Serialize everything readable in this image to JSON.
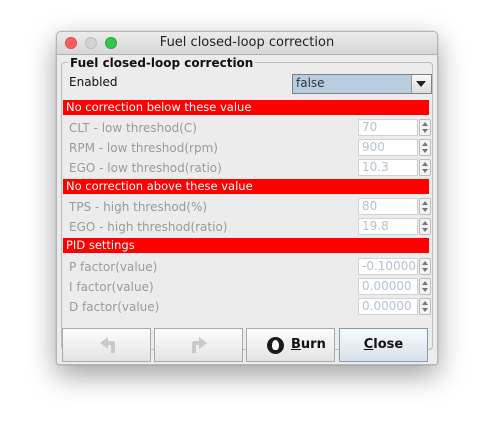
{
  "window": {
    "title": "Fuel closed-loop correction"
  },
  "panel": {
    "title": "Fuel closed-loop correction"
  },
  "enabled": {
    "label": "Enabled",
    "value": "false"
  },
  "sections": {
    "below": "No correction below these value",
    "above": "No correction above these value",
    "pid": "PID settings"
  },
  "fields": {
    "clt_low": {
      "label": "CLT - low threshod(C)",
      "value": "70"
    },
    "rpm_low": {
      "label": "RPM - low threshod(rpm)",
      "value": "900"
    },
    "ego_low": {
      "label": "EGO - low threshod(ratio)",
      "value": "10.3"
    },
    "tps_high": {
      "label": "TPS - high threshod(%)",
      "value": "80"
    },
    "ego_high": {
      "label": "EGO - high threshod(ratio)",
      "value": "19.8"
    },
    "p_factor": {
      "label": "P factor(value)",
      "value": "-0.10000"
    },
    "i_factor": {
      "label": "I factor(value)",
      "value": "0.00000"
    },
    "d_factor": {
      "label": "D factor(value)",
      "value": "0.00000"
    }
  },
  "buttons": {
    "burn_underlined": "B",
    "burn_rest": "urn",
    "close_underlined": "C",
    "close_rest": "lose"
  },
  "colors": {
    "section_red": "#ff0000",
    "dropdown_bg": "#b8cde0"
  }
}
